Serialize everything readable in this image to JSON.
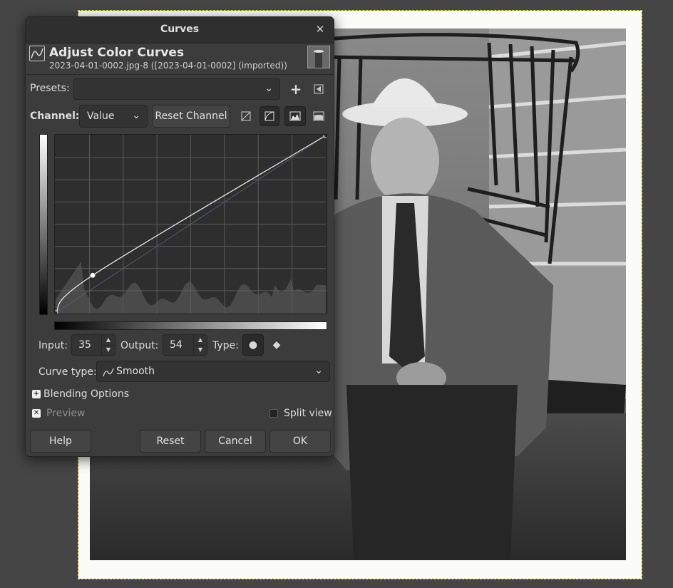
{
  "dialog": {
    "title": "Curves",
    "header_title": "Adjust Color Curves",
    "header_subtitle": "2023-04-01-0002.jpg-8 ([2023-04-01-0002] (imported))",
    "header_icon": "curve-icon",
    "thumbnail": "image-thumbnail"
  },
  "presets": {
    "label": "Presets:",
    "value": "",
    "add_icon": "plus-icon",
    "menu_icon": "triangle-menu-icon"
  },
  "channel": {
    "label": "Channel:",
    "value": "Value",
    "reset_label": "Reset Channel",
    "icons": [
      "linear-mode-icon",
      "perceptual-mode-icon",
      "linear-histogram-icon",
      "log-histogram-icon"
    ]
  },
  "curve": {
    "points": [
      [
        0,
        0
      ],
      [
        35,
        54
      ],
      [
        255,
        255
      ]
    ],
    "selected_point": [
      35,
      54
    ],
    "range": [
      0,
      255
    ],
    "grid_divisions": 8
  },
  "point_editor": {
    "input_label": "Input:",
    "input_value": "35",
    "output_label": "Output:",
    "output_value": "54",
    "type_label": "Type:",
    "type_icons": [
      "smooth-point-icon",
      "corner-point-icon"
    ]
  },
  "curve_type": {
    "label": "Curve type:",
    "value": "Smooth",
    "icon": "smooth-curve-icon"
  },
  "blending_options": {
    "label": "Blending Options"
  },
  "preview": {
    "label": "Preview",
    "checked": true
  },
  "split_view": {
    "label": "Split view",
    "checked": false
  },
  "buttons": {
    "help": "Help",
    "reset": "Reset",
    "cancel": "Cancel",
    "ok": "OK"
  },
  "colors": {
    "dialog_bg": "#3c3c3c",
    "canvas_bg": "#454545",
    "selection_outline": "#d4d400"
  }
}
